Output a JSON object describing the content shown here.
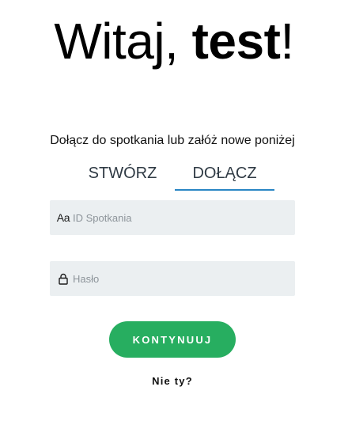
{
  "greeting": {
    "prefix": "Witaj, ",
    "user": "test",
    "suffix": "!"
  },
  "subtitle": "Dołącz do spotkania lub załóż nowe poniżej",
  "tabs": [
    {
      "label": "STWÓRZ",
      "active": false
    },
    {
      "label": "DOŁĄCZ",
      "active": true
    }
  ],
  "fields": {
    "meeting_id": {
      "icon_text": "Aa",
      "icon": "text-format-icon",
      "placeholder": "ID Spotkania",
      "value": ""
    },
    "password": {
      "icon": "lock-icon",
      "placeholder": "Hasło",
      "value": ""
    }
  },
  "continue_button": {
    "label": "KONTYNUUJ"
  },
  "not_you_link": {
    "label": "Nie ty?"
  },
  "colors": {
    "accent_green": "#27ae60",
    "tab_underline": "#2a86c4",
    "field_background": "#ebeff1"
  }
}
